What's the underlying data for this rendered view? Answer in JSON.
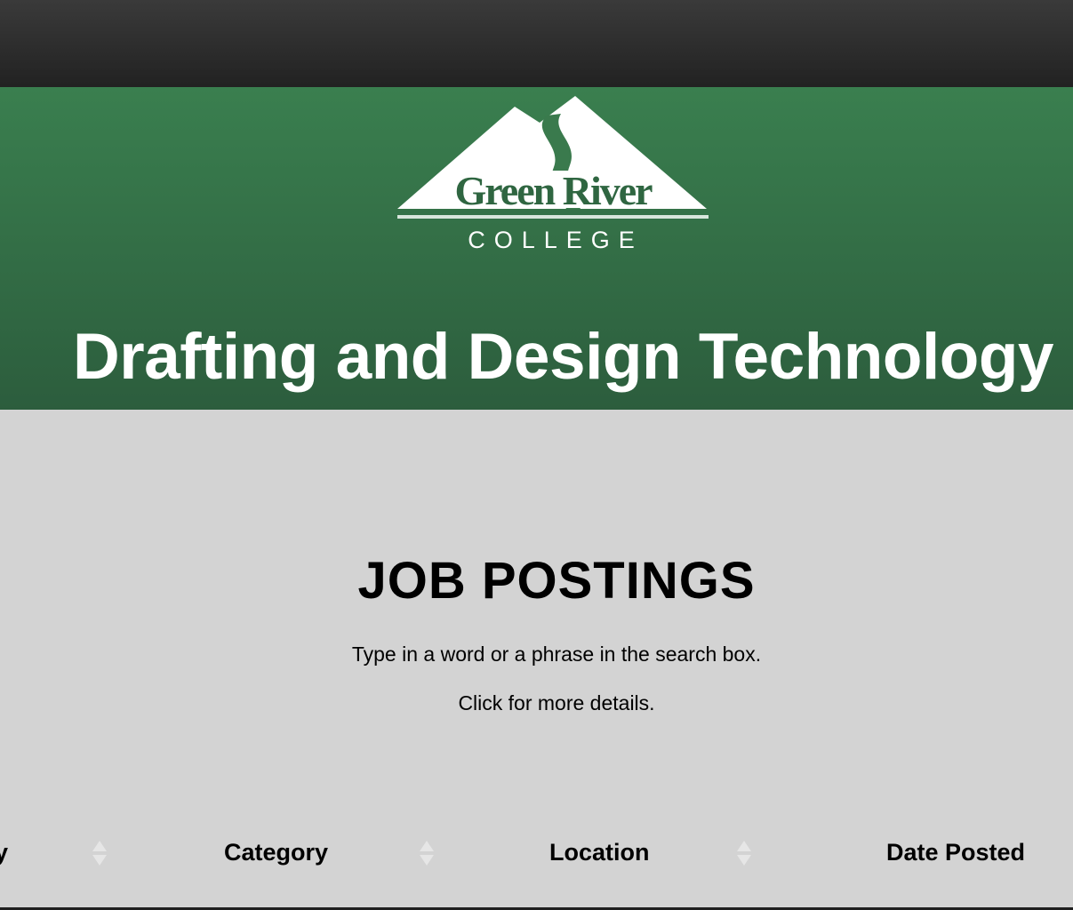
{
  "header": {
    "logo": {
      "name_line1": "Green River",
      "name_line2": "COLLEGE",
      "icon": "mountain-river-logo-icon"
    },
    "program_title": "Drafting and Design Technology"
  },
  "main": {
    "heading": "JOB POSTINGS",
    "instructions": [
      "Type in a word or a phrase in the search box.",
      "Click for more details."
    ],
    "table": {
      "columns": [
        {
          "label": "y",
          "sort_icon": "sort-arrows-icon"
        },
        {
          "label": "Category",
          "sort_icon": "sort-arrows-icon"
        },
        {
          "label": "Location",
          "sort_icon": "sort-arrows-icon"
        },
        {
          "label": "Date Posted"
        }
      ]
    }
  },
  "colors": {
    "topbar": "#2e2e2e",
    "hero_green": "#35704a",
    "content_bg": "#d3d3d3",
    "sort_icon": "#e6e6e6"
  }
}
